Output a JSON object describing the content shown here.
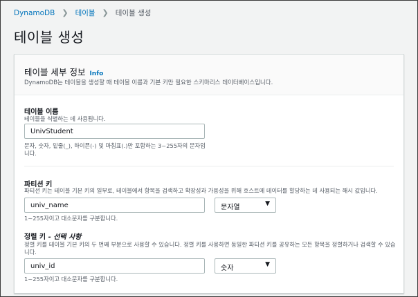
{
  "breadcrumb": {
    "items": [
      "DynamoDB",
      "테이블",
      "테이블 생성"
    ]
  },
  "page": {
    "title": "테이블 생성"
  },
  "panel": {
    "title": "테이블 세부 정보",
    "info": "Info",
    "description": "DynamoDB는 테이블을 생성할 때 테이블 이름과 기본 키만 필요한 스키마리스 데이터베이스입니다."
  },
  "table_name": {
    "label": "테이블 이름",
    "description": "테이블을 식별하는 데 사용됩니다.",
    "value": "UnivStudent",
    "constraint_line1": "문자, 숫자, 밑줄(_), 하이픈(-) 및 마침표(.)만 포함하는 3~255자의 문자입",
    "constraint_line2": "니다."
  },
  "partition_key": {
    "label": "파티션 키",
    "description": "파티션 키는 테이블 기본 키의 일부로, 테이블에서 항목을 검색하고 확장성과 가용성을 위해 호스트에 데이터를 할당하는 데 사용되는 해시 값입니다.",
    "value": "univ_name",
    "type": "문자열",
    "constraint": "1~255자이고 대소문자를 구분합니다."
  },
  "sort_key": {
    "label": "정렬 키",
    "optional": "- 선택 사항",
    "description_line1": "정렬 키를 테이블 기본 키의 두 번째 부분으로 사용할 수 있습니다. 정렬 키를 사용하면 동일한 파티션 키를 공유하는 모든 항목을 정렬하거나 검색할 수 있습",
    "description_line2": "니다.",
    "value": "univ_id",
    "type": "숫자",
    "constraint": "1~255자이고 대소문자를 구분합니다."
  },
  "colors": {
    "link": "#0073bb",
    "background": "#f2f3f3",
    "muted_text": "#545b64"
  }
}
